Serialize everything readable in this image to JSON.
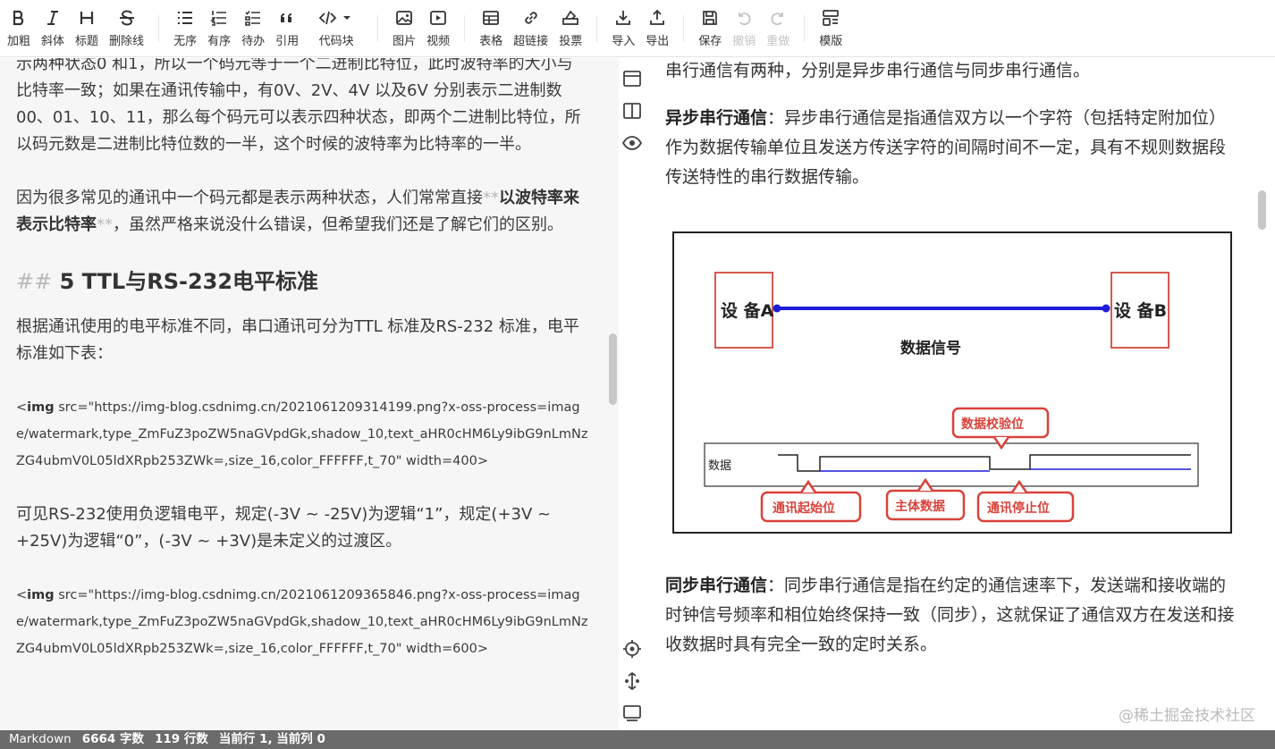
{
  "toolbar": {
    "groups": [
      [
        {
          "label": "加粗",
          "icon": "bold-icon"
        },
        {
          "label": "斜体",
          "icon": "italic-icon"
        },
        {
          "label": "标题",
          "icon": "heading-icon"
        },
        {
          "label": "删除线",
          "icon": "strikethrough-icon"
        }
      ],
      [
        {
          "label": "无序",
          "icon": "unordered-list-icon"
        },
        {
          "label": "有序",
          "icon": "ordered-list-icon"
        },
        {
          "label": "待办",
          "icon": "todo-list-icon"
        },
        {
          "label": "引用",
          "icon": "quote-icon"
        },
        {
          "label": "代码块",
          "icon": "code-block-icon"
        }
      ],
      [
        {
          "label": "图片",
          "icon": "image-icon"
        },
        {
          "label": "视频",
          "icon": "video-icon"
        }
      ],
      [
        {
          "label": "表格",
          "icon": "table-icon"
        },
        {
          "label": "超链接",
          "icon": "link-icon"
        },
        {
          "label": "投票",
          "icon": "vote-icon"
        }
      ],
      [
        {
          "label": "导入",
          "icon": "import-icon"
        },
        {
          "label": "导出",
          "icon": "export-icon"
        }
      ],
      [
        {
          "label": "保存",
          "icon": "save-icon"
        },
        {
          "label": "撤销",
          "icon": "undo-icon"
        },
        {
          "label": "重做",
          "icon": "redo-icon"
        }
      ],
      [
        {
          "label": "模版",
          "icon": "template-icon"
        }
      ]
    ]
  },
  "editor": {
    "para1": "示两种状态0 和1，所以一个码元等于一个二进制比特位，此时波特率的大小与比特率一致；如果在通讯传输中，有0V、2V、4V 以及6V 分别表示二进制数00、01、10、11，那么每个码元可以表示四种状态，即两个二进制比特位，所以码元数是二进制比特位数的一半，这个时候的波特率为比特率的一半。",
    "para2_before": "因为很多常见的通讯中一个码元都是表示两种状态，人们常常直接",
    "para2_bold": "以波特率来表示比特率",
    "para2_after": "，虽然严格来说没什么错误，但希望我们还是了解它们的区别。",
    "bold_mark": "**",
    "heading_mark": "##",
    "heading_text": "5 TTL与RS-232电平标准",
    "para3": "根据通讯使用的电平标准不同，串口通讯可分为TTL 标准及RS-232 标准，电平标准如下表：",
    "img1_tag_open": "<",
    "img1_tag_name": "img",
    "img1_attrs": " src=\"https://img-blog.csdnimg.cn/2021061209314199.png?x-oss-process=image/watermark,type_ZmFuZ3poZW5naGVpdGk,shadow_10,text_aHR0cHM6Ly9ibG9nLmNzZG4ubmV0L05ldXRpb253ZWk=,size_16,color_FFFFFF,t_70\" width=400>",
    "para4": "可见RS-232使用负逻辑电平，规定(-3V ~ -25V)为逻辑“1”，规定(+3V ~ +25V)为逻辑“0”，(-3V ~ +3V)是未定义的过渡区。",
    "img2_attrs": " src=\"https://img-blog.csdnimg.cn/2021061209365846.png?x-oss-process=image/watermark,type_ZmFuZ3poZW5naGVpdGk,shadow_10,text_aHR0cHM6Ly9ibG9nLmNzZG4ubmV0L05ldXRpb253ZWk=,size_16,color_FFFFFF,t_70\" width=600>"
  },
  "preview": {
    "intro": "串行通信有两种，分别是异步串行通信与同步串行通信。",
    "async_title": "异步串行通信",
    "async_text": "：异步串行通信是指通信双方以一个字符（包括特定附加位）作为数据传输单位且发送方传送字符的间隔时间不一定，具有不规则数据段传送特性的串行数据传输。",
    "figure": {
      "device_a": "设 备A",
      "device_b": "设 备B",
      "signal_label": "数据信号",
      "checksum_label": "数据校验位",
      "data_label": "数据",
      "start_label": "通讯起始位",
      "body_label": "主体数据",
      "stop_label": "通讯停止位",
      "link_color": "#1d1dd8",
      "callout_color": "#d9423a"
    },
    "sync_title": "同步串行通信",
    "sync_text": "：同步串行通信是指在约定的通信速率下，发送端和接收端的时钟信号频率和相位始终保持一致（同步），这就保证了通信双方在发送和接收数据时具有完全一致的定时关系。",
    "juejin_mark": "@稀土掘金技术社区"
  },
  "status": {
    "mode": "Markdown",
    "chars": "6664 字数",
    "lines": "119 行数",
    "cursor": "当前行 1, 当前列 0"
  }
}
